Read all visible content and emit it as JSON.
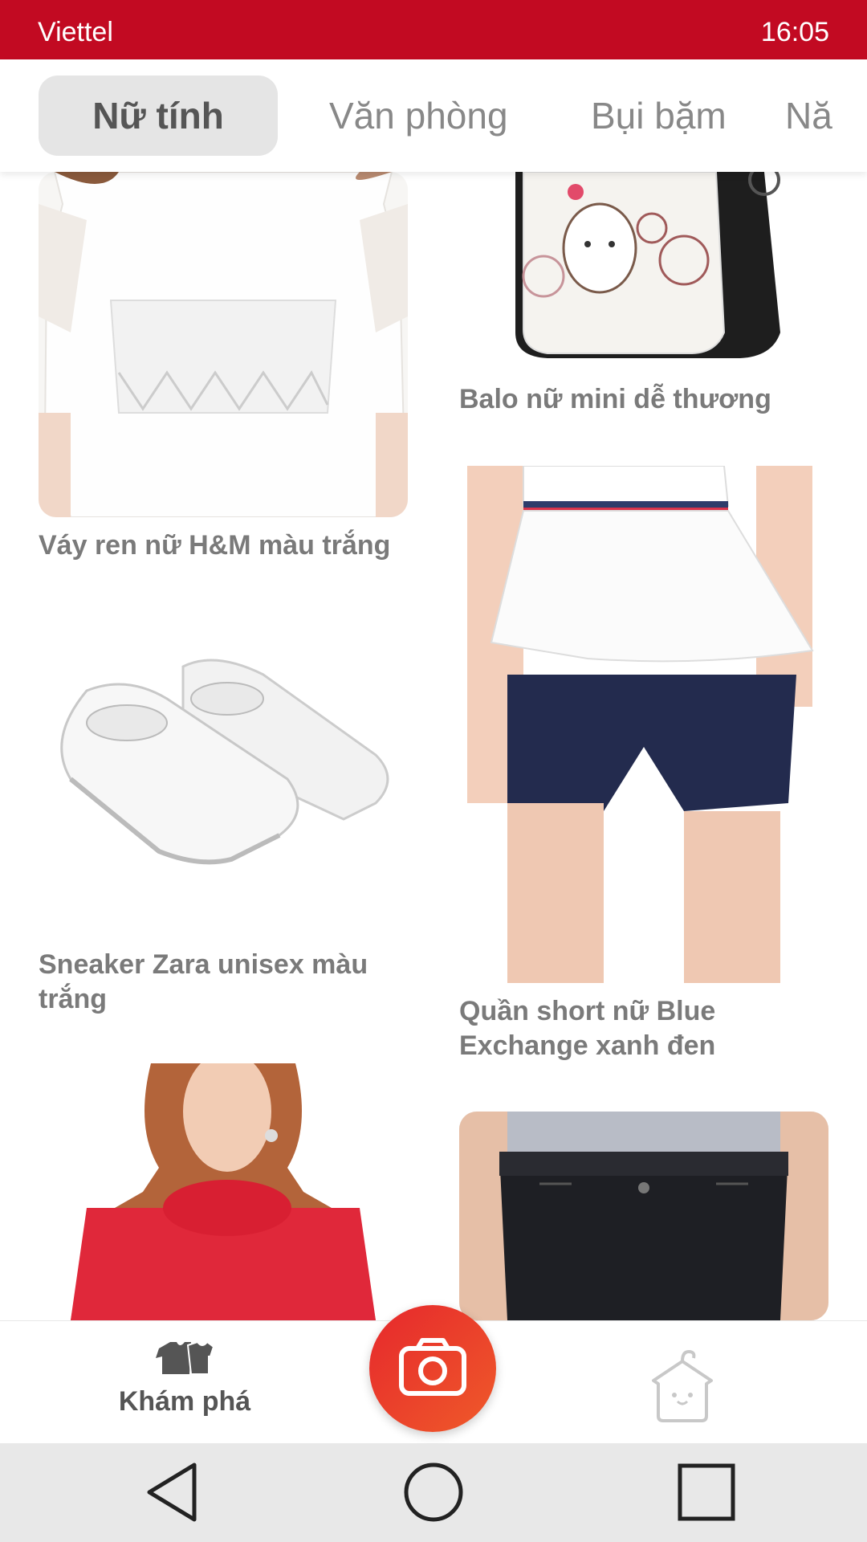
{
  "status_bar": {
    "carrier": "Viettel",
    "time": "16:05"
  },
  "tabs": [
    {
      "label": "Nữ tính",
      "active": true
    },
    {
      "label": "Văn phòng",
      "active": false
    },
    {
      "label": "Bụi bặm",
      "active": false
    },
    {
      "label": "Nă",
      "active": false
    }
  ],
  "products": [
    {
      "title": "Váy ren nữ H&M màu trắng"
    },
    {
      "title": "Balo nữ mini dễ thương"
    },
    {
      "title": "Sneaker Zara unisex màu trắng"
    },
    {
      "title": "Quần short nữ Blue Exchange xanh đen"
    }
  ],
  "bottom_nav": {
    "explore_label": "Khám phá"
  },
  "colors": {
    "brand": "#c20a22",
    "accent": "#e6282c",
    "tab_active_bg": "#e5e5e5"
  },
  "icons": [
    "clothes-icon",
    "camera-icon",
    "wardrobe-hanger-icon",
    "back-icon",
    "home-icon",
    "recents-icon"
  ]
}
